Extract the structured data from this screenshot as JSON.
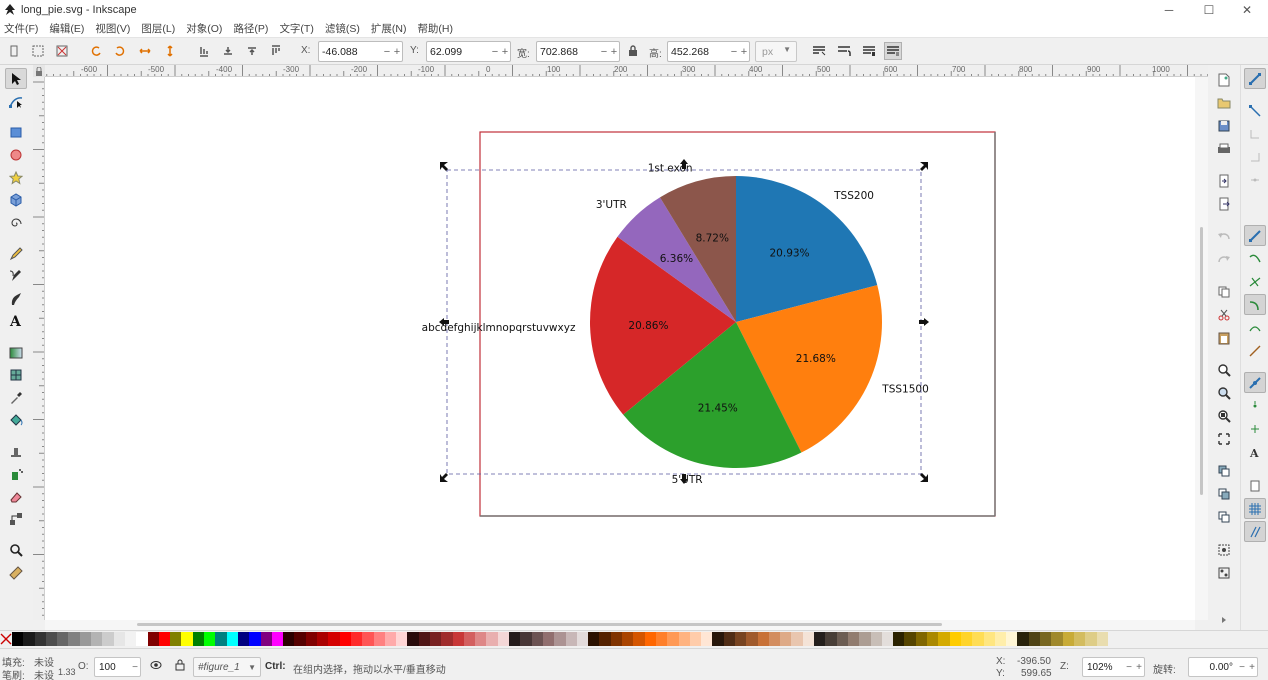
{
  "window": {
    "title": "long_pie.svg - Inkscape",
    "controls": {
      "minimize": "─",
      "maximize": "☐",
      "close": "✕"
    }
  },
  "menu": [
    "文件(F)",
    "编辑(E)",
    "视图(V)",
    "图层(L)",
    "对象(O)",
    "路径(P)",
    "文字(T)",
    "滤镜(S)",
    "扩展(N)",
    "帮助(H)"
  ],
  "toolbar": {
    "x_label": "X:",
    "x_value": "-46.088",
    "y_label": "Y:",
    "y_value": "62.099",
    "w_label": "宽:",
    "w_value": "702.868",
    "h_label": "高:",
    "h_value": "452.268",
    "unit": "px",
    "minus": "−",
    "plus": "+"
  },
  "ruler": {
    "top": [
      "-600",
      "-500",
      "-400",
      "-300",
      "-200",
      "-100",
      "0",
      "100",
      "200",
      "300",
      "400",
      "500",
      "600",
      "700",
      "800",
      "900",
      "1000"
    ],
    "left": [
      "0",
      "100",
      "200",
      "300",
      "400",
      "500",
      "600",
      "700"
    ]
  },
  "chart_data": {
    "type": "pie",
    "categories": [
      "TSS200",
      "TSS1500",
      "5'UTR",
      "abcdefghijklmnopqrstuvwxyz",
      "3'UTR",
      "1st exon"
    ],
    "values": [
      20.93,
      21.68,
      21.45,
      20.86,
      6.36,
      8.72
    ],
    "percent_labels": [
      "20.93%",
      "21.68%",
      "21.45%",
      "20.86%",
      "6.36%",
      "8.72%"
    ],
    "colors": [
      "#1f77b4",
      "#ff7f0e",
      "#2ca02c",
      "#d62728",
      "#9467bd",
      "#8c564b"
    ]
  },
  "palette": [
    "#000000",
    "#1a1a1a",
    "#333333",
    "#4d4d4d",
    "#666666",
    "#808080",
    "#999999",
    "#b3b3b3",
    "#cccccc",
    "#e6e6e6",
    "#f2f2f2",
    "#ffffff",
    "#800000",
    "#ff0000",
    "#808000",
    "#ffff00",
    "#008000",
    "#00ff00",
    "#008080",
    "#00ffff",
    "#000080",
    "#0000ff",
    "#800080",
    "#ff00ff",
    "#2b0000",
    "#550000",
    "#800000",
    "#aa0000",
    "#d40000",
    "#ff0000",
    "#ff2a2a",
    "#ff5555",
    "#ff8080",
    "#ffaaaa",
    "#ffd5d5",
    "#280b0b",
    "#501616",
    "#782121",
    "#a02c2c",
    "#c83737",
    "#d35f5f",
    "#de8787",
    "#e9afaf",
    "#f4d7d7",
    "#241c1c",
    "#483737",
    "#6c5353",
    "#916f6f",
    "#ac9393",
    "#c8b7b7",
    "#e3dbdb",
    "#2b1100",
    "#552200",
    "#803300",
    "#aa4400",
    "#d45500",
    "#ff6600",
    "#ff7f2a",
    "#ff9955",
    "#ffb380",
    "#ffccaa",
    "#ffe6d5",
    "#28170b",
    "#502d16",
    "#784421",
    "#a05a2c",
    "#c87137",
    "#d38d5f",
    "#deaa87",
    "#e9c6af",
    "#f4e3d7",
    "#241f1c",
    "#483e37",
    "#6c5d53",
    "#917c6f",
    "#ac9d93",
    "#c8beb7",
    "#e3dedb",
    "#2b2200",
    "#554400",
    "#806600",
    "#aa8800",
    "#d4aa00",
    "#ffcc00",
    "#ffd42a",
    "#ffdd55",
    "#ffe680",
    "#ffeeaa",
    "#fff6d5",
    "#28220b",
    "#504416",
    "#786721",
    "#a0892c",
    "#c8ab37",
    "#d3bc5f",
    "#decd87",
    "#e9ddaf"
  ],
  "status": {
    "fill_label": "填充:",
    "fill_value": "未设",
    "stroke_label": "笔刷:",
    "stroke_value": "未设",
    "stroke_width": "1.33",
    "opacity_label": "O:",
    "opacity_value": "100",
    "layer": "#figure_1",
    "hint_key": "Ctrl:",
    "hint_text": "在组内选择，拖动以水平/垂直移动",
    "x_label": "X:",
    "x_value": "-396.50",
    "y_label": "Y:",
    "y_value": "599.65",
    "zoom_label": "Z:",
    "zoom_value": "102%",
    "rotate_label": "旋转:",
    "rotate_value": "0.00°"
  }
}
